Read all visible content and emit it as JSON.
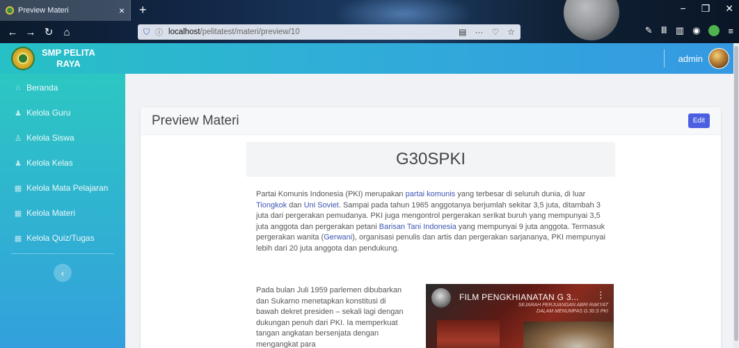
{
  "browser": {
    "tab_title": "Preview Materi",
    "tab_close": "×",
    "new_tab": "+",
    "url_host": "localhost",
    "url_path": "/pelitatest/materi/preview/10",
    "url_menu": "···"
  },
  "header": {
    "brand_line1": "SMP PELITA",
    "brand_line2": "RAYA",
    "user_name": "admin"
  },
  "sidebar": {
    "items": [
      {
        "label": "Beranda",
        "icon": "home-icon"
      },
      {
        "label": "Kelola Guru",
        "icon": "user-icon"
      },
      {
        "label": "Kelola Siswa",
        "icon": "users-icon"
      },
      {
        "label": "Kelola Kelas",
        "icon": "user-icon"
      },
      {
        "label": "Kelola Mata Pelajaran",
        "icon": "table-icon"
      },
      {
        "label": "Kelola Materi",
        "icon": "table-icon"
      },
      {
        "label": "Kelola Quiz/Tugas",
        "icon": "table-icon"
      }
    ],
    "collapse_label": "‹"
  },
  "card": {
    "title": "Preview Materi",
    "edit_label": "Edit"
  },
  "document": {
    "title": "G30SPKI",
    "para1": {
      "t1": "Partai Komunis Indonesia (PKI) merupakan ",
      "l1": "partai komunis",
      "t2": " yang terbesar di seluruh dunia, di luar ",
      "l2": "Tiongkok",
      "t3": " dan ",
      "l3": "Uni Soviet",
      "t4": ". Sampai pada tahun 1965 anggotanya berjumlah sekitar 3,5 juta, ditambah 3 juta dari pergerakan pemudanya. PKI juga mengontrol pergerakan serikat buruh yang mempunyai 3,5 juta anggota dan pergerakan petani ",
      "l4": "Barisan Tani Indonesia",
      "t5": " yang mempunyai 9 juta anggota. Termasuk pergerakan wanita (",
      "l5": "Gerwani",
      "t6": "), organisasi penulis dan artis dan pergerakan sarjananya, PKI mempunyai lebih dari 20 juta anggota dan pendukung."
    },
    "para2": "Pada bulan Juli 1959 parlemen dibubarkan dan Sukarno menetapkan konstitusi di bawah dekret presiden – sekali lagi dengan dukungan penuh dari PKI. Ia memperkuat tangan angkatan bersenjata dengan mengangkat para",
    "video": {
      "title": "FILM PENGKHIANATAN G 3...",
      "subtitle_line1": "SEJARAH PERJUANGAN ABRI RAKYAT",
      "subtitle_line2": "DALAM MENUMPAS G.30.S PKI",
      "menu": "⋮"
    }
  }
}
